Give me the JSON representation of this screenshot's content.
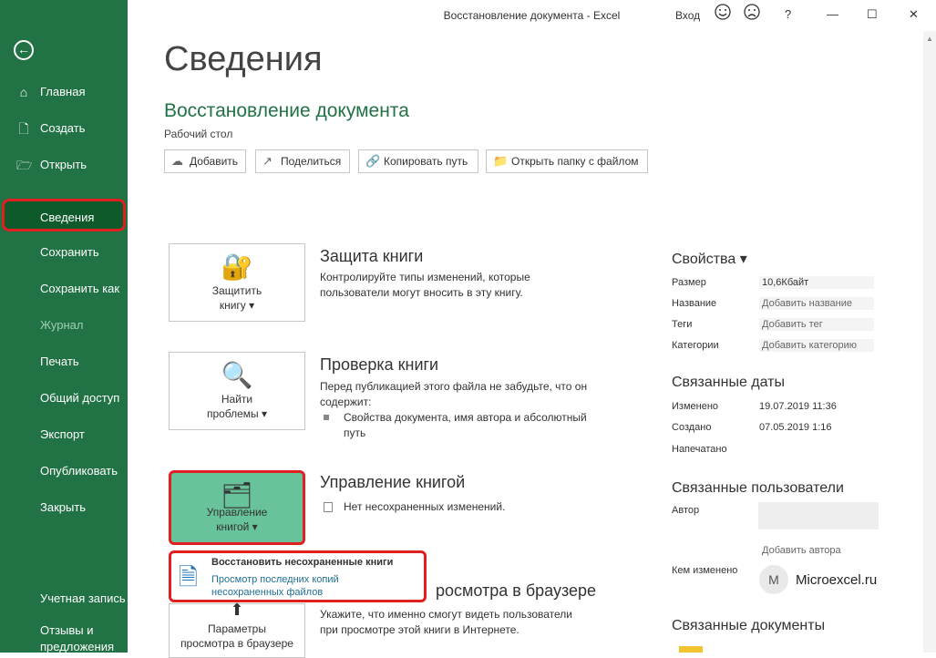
{
  "window": {
    "title": "Восстановление документа  -  Excel",
    "sign_in": "Вход",
    "smile_icon": "smiley-icon",
    "frown_icon": "frowny-icon",
    "help": "?",
    "minimize": "—",
    "maximize": "☐",
    "close": "✕"
  },
  "sidebar": {
    "back": "←",
    "items": [
      {
        "label": "Главная",
        "icon": "⌂"
      },
      {
        "label": "Создать",
        "icon": "🗋"
      },
      {
        "label": "Открыть",
        "icon": "🗁"
      },
      {
        "label": "Сведения"
      },
      {
        "label": "Сохранить"
      },
      {
        "label": "Сохранить как"
      },
      {
        "label": "Журнал"
      },
      {
        "label": "Печать"
      },
      {
        "label": "Общий доступ"
      },
      {
        "label": "Экспорт"
      },
      {
        "label": "Опубликовать"
      },
      {
        "label": "Закрыть"
      },
      {
        "label": "Учетная запись"
      },
      {
        "label": "Отзывы и"
      },
      {
        "label": "предложения"
      }
    ]
  },
  "main": {
    "heading": "Сведения",
    "doc_title": "Восстановление документа",
    "location": "Рабочий стол",
    "buttons": [
      {
        "label": "Добавить",
        "icon": "☁"
      },
      {
        "label": "Поделиться",
        "icon": "↗"
      },
      {
        "label": "Копировать путь",
        "icon": "🔗"
      },
      {
        "label": "Открыть папку с файлом",
        "icon": "📁"
      }
    ],
    "protect": {
      "card_icon": "🔐",
      "card_line1": "Защитить",
      "card_line2": "книгу ▾",
      "heading": "Защита книги",
      "text": "Контролируйте типы изменений, которые пользователи могут вносить в эту книгу."
    },
    "inspect": {
      "card_icon": "🔍",
      "card_line1": "Найти",
      "card_line2": "проблемы ▾",
      "heading": "Проверка книги",
      "text": "Перед публикацией этого файла не забудьте, что он содержит:",
      "bullet": "Свойства документа, имя автора и абсолютный путь"
    },
    "manage": {
      "card_icon": "🗂",
      "card_line1": "Управление",
      "card_line2": "книгой ▾",
      "heading": "Управление книгой",
      "bullet": "Нет несохраненных изменений."
    },
    "popup": {
      "icon": "🗎",
      "title": "Восстановить несохраненные книги",
      "sub1": "Просмотр последних копий",
      "sub2": "несохраненных файлов"
    },
    "browser": {
      "heading_tail": "росмотра в браузере",
      "text": "Укажите, что именно смогут видеть пользователи при просмотре этой книги в Интернете.",
      "card_line1": "Параметры",
      "card_line2": "просмотра в браузере"
    }
  },
  "properties": {
    "heading": "Свойства ▾",
    "rows": [
      {
        "key": "Размер",
        "value": "10,6Кбайт"
      },
      {
        "key": "Название",
        "value": "Добавить название"
      },
      {
        "key": "Теги",
        "value": "Добавить тег"
      },
      {
        "key": "Категории",
        "value": "Добавить категорию"
      }
    ],
    "dates_heading": "Связанные даты",
    "dates": [
      {
        "key": "Изменено",
        "value": "19.07.2019 11:36"
      },
      {
        "key": "Создано",
        "value": "07.05.2019 1:16"
      },
      {
        "key": "Напечатано",
        "value": ""
      }
    ],
    "people_heading": "Связанные пользователи",
    "author_label": "Автор",
    "add_author": "Добавить автора",
    "modified_by_label": "Кем изменено",
    "modified_by_initial": "M",
    "modified_by_name": "Microexcel.ru",
    "docs_heading": "Связанные документы"
  }
}
